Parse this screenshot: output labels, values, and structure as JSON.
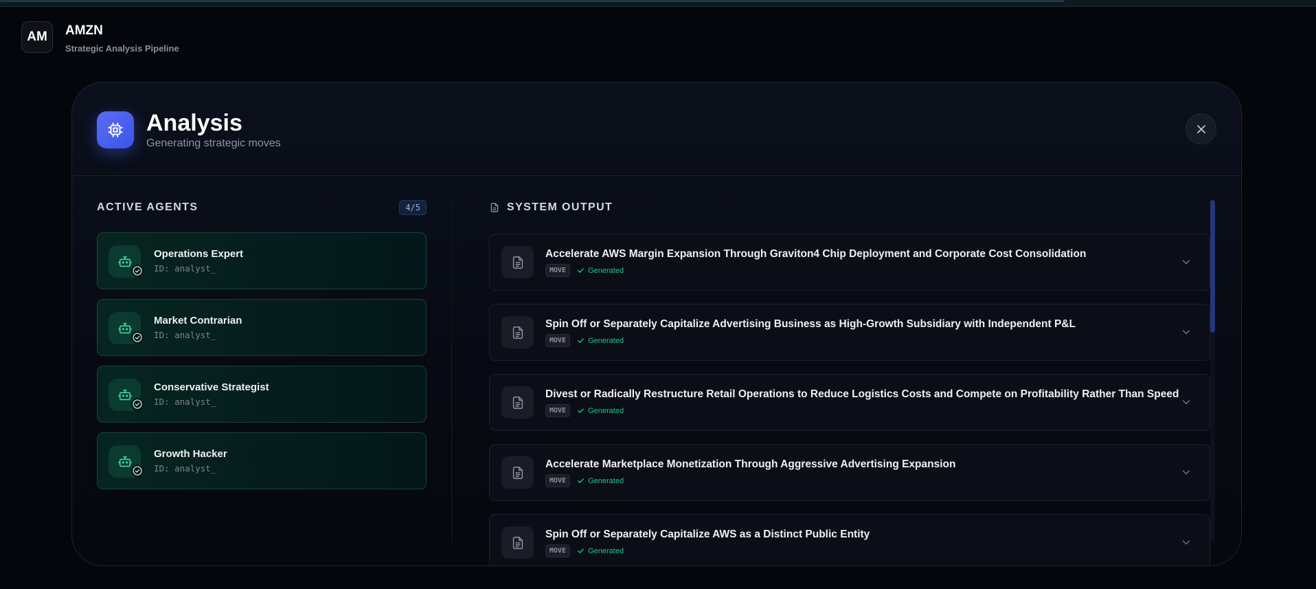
{
  "app": {
    "logo_text": "AM",
    "title": "AMZN",
    "subtitle": "Strategic Analysis Pipeline"
  },
  "modal": {
    "icon": "cpu-chip-icon",
    "title": "Analysis",
    "subtitle": "Generating strategic moves",
    "close_icon": "close-icon"
  },
  "agents": {
    "title": "ACTIVE AGENTS",
    "count": "4/5",
    "items": [
      {
        "name": "Operations Expert",
        "id": "ID: analyst_",
        "icon": "robot-icon",
        "status": "completed"
      },
      {
        "name": "Market Contrarian",
        "id": "ID: analyst_",
        "icon": "robot-icon",
        "status": "completed"
      },
      {
        "name": "Conservative Strategist",
        "id": "ID: analyst_",
        "icon": "robot-icon",
        "status": "completed"
      },
      {
        "name": "Growth Hacker",
        "id": "ID: analyst_",
        "icon": "robot-icon",
        "status": "completed"
      }
    ]
  },
  "output": {
    "title": "SYSTEM OUTPUT",
    "icon": "document-icon",
    "moves": [
      {
        "title": "Accelerate AWS Margin Expansion Through Graviton4 Chip Deployment and Corporate Cost Consolidation",
        "badge": "MOVE",
        "status": "Generated"
      },
      {
        "title": "Spin Off or Separately Capitalize Advertising Business as High-Growth Subsidiary with Independent P&L",
        "badge": "MOVE",
        "status": "Generated"
      },
      {
        "title": "Divest or Radically Restructure Retail Operations to Reduce Logistics Costs and Compete on Profitability Rather Than Speed",
        "badge": "MOVE",
        "status": "Generated"
      },
      {
        "title": "Accelerate Marketplace Monetization Through Aggressive Advertising Expansion",
        "badge": "MOVE",
        "status": "Generated"
      },
      {
        "title": "Spin Off or Separately Capitalize AWS as a Distinct Public Entity",
        "badge": "MOVE",
        "status": "Generated"
      }
    ]
  },
  "colors": {
    "accent": "#4a5ff0",
    "success": "#24c48a",
    "agent_card_border": "#17433a"
  }
}
